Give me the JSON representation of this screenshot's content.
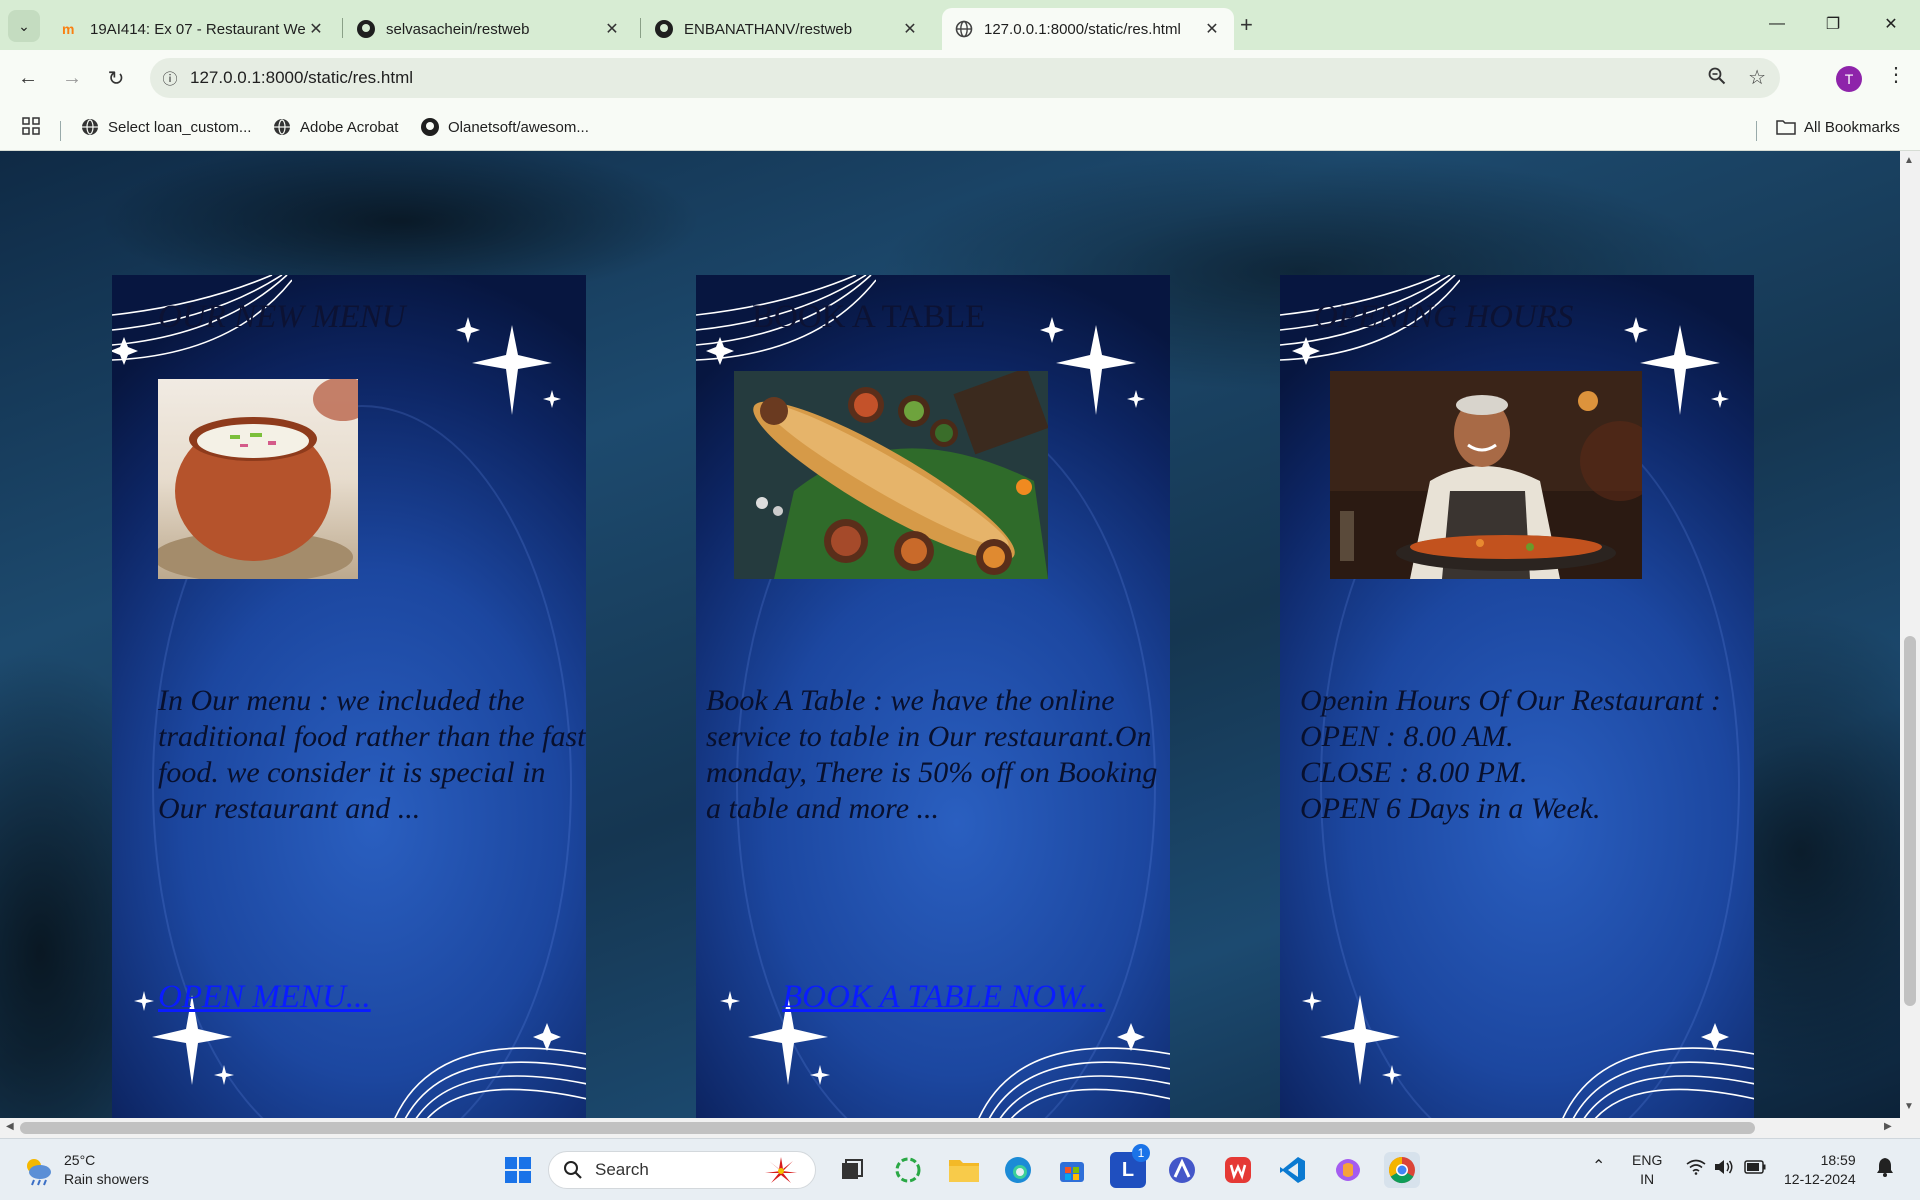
{
  "browser": {
    "tabs": [
      {
        "title": "19AI414: Ex 07 - Restaurant We",
        "icon": "moodle-icon"
      },
      {
        "title": "selvasachein/restweb",
        "icon": "github-icon"
      },
      {
        "title": "ENBANATHANV/restweb",
        "icon": "github-icon"
      },
      {
        "title": "127.0.0.1:8000/static/res.html",
        "icon": "globe-icon",
        "active": true
      }
    ],
    "url": "127.0.0.1:8000/static/res.html",
    "profile_initial": "T",
    "bookmarks": [
      {
        "label": "Select loan_custom...",
        "icon": "globe-icon"
      },
      {
        "label": "Adobe Acrobat",
        "icon": "globe-icon"
      },
      {
        "label": "Olanetsoft/awesom...",
        "icon": "github-icon"
      }
    ],
    "all_bookmarks_label": "All Bookmarks"
  },
  "page": {
    "cards": [
      {
        "title": "OUR NEW MENU",
        "text": "In Our menu : we included the traditional food rather than the fast food. we consider it is special in Our restaurant and ...",
        "link": "OPEN MENU...",
        "image": "bowl of buttermilk in clay pot"
      },
      {
        "title": "BOOK A TABLE",
        "text": "Book A Table : we have the online service to table in Our restaurant.On monday, There is 50% off on Booking a table and more ...",
        "link": "BOOK A TABLE NOW...",
        "image": "dosa on banana leaf with chutneys"
      },
      {
        "title": "OPENING HOURS",
        "text_lines": [
          "Openin Hours Of Our Restaurant :",
          "OPEN : 8.00 AM.",
          "CLOSE : 8.00 PM.",
          "OPEN 6 Days in a Week."
        ],
        "link": "",
        "image": "smiling chef cooking"
      }
    ],
    "colors": {
      "card_dark": "#071640",
      "card_mid": "#2a5fc0",
      "link": "#0a1cff"
    }
  },
  "taskbar": {
    "weather_temp": "25°C",
    "weather_desc": "Rain showers",
    "search_placeholder": "Search",
    "lang_top": "ENG",
    "lang_bottom": "IN",
    "time": "18:59",
    "date": "12-12-2024",
    "app_badge": "1"
  }
}
